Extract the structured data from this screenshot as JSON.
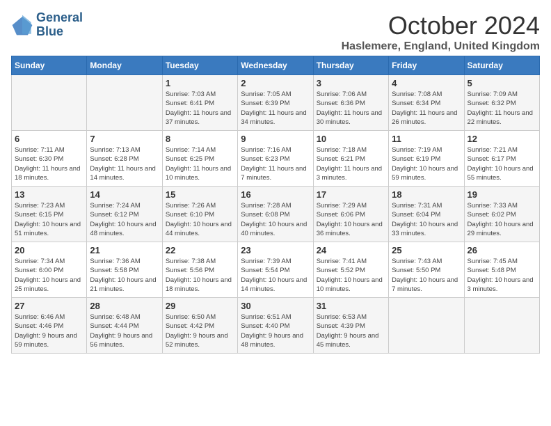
{
  "logo": {
    "line1": "General",
    "line2": "Blue"
  },
  "title": "October 2024",
  "location": "Haslemere, England, United Kingdom",
  "days_header": [
    "Sunday",
    "Monday",
    "Tuesday",
    "Wednesday",
    "Thursday",
    "Friday",
    "Saturday"
  ],
  "weeks": [
    [
      {
        "day": "",
        "info": ""
      },
      {
        "day": "",
        "info": ""
      },
      {
        "day": "1",
        "info": "Sunrise: 7:03 AM\nSunset: 6:41 PM\nDaylight: 11 hours and 37 minutes."
      },
      {
        "day": "2",
        "info": "Sunrise: 7:05 AM\nSunset: 6:39 PM\nDaylight: 11 hours and 34 minutes."
      },
      {
        "day": "3",
        "info": "Sunrise: 7:06 AM\nSunset: 6:36 PM\nDaylight: 11 hours and 30 minutes."
      },
      {
        "day": "4",
        "info": "Sunrise: 7:08 AM\nSunset: 6:34 PM\nDaylight: 11 hours and 26 minutes."
      },
      {
        "day": "5",
        "info": "Sunrise: 7:09 AM\nSunset: 6:32 PM\nDaylight: 11 hours and 22 minutes."
      }
    ],
    [
      {
        "day": "6",
        "info": "Sunrise: 7:11 AM\nSunset: 6:30 PM\nDaylight: 11 hours and 18 minutes."
      },
      {
        "day": "7",
        "info": "Sunrise: 7:13 AM\nSunset: 6:28 PM\nDaylight: 11 hours and 14 minutes."
      },
      {
        "day": "8",
        "info": "Sunrise: 7:14 AM\nSunset: 6:25 PM\nDaylight: 11 hours and 10 minutes."
      },
      {
        "day": "9",
        "info": "Sunrise: 7:16 AM\nSunset: 6:23 PM\nDaylight: 11 hours and 7 minutes."
      },
      {
        "day": "10",
        "info": "Sunrise: 7:18 AM\nSunset: 6:21 PM\nDaylight: 11 hours and 3 minutes."
      },
      {
        "day": "11",
        "info": "Sunrise: 7:19 AM\nSunset: 6:19 PM\nDaylight: 10 hours and 59 minutes."
      },
      {
        "day": "12",
        "info": "Sunrise: 7:21 AM\nSunset: 6:17 PM\nDaylight: 10 hours and 55 minutes."
      }
    ],
    [
      {
        "day": "13",
        "info": "Sunrise: 7:23 AM\nSunset: 6:15 PM\nDaylight: 10 hours and 51 minutes."
      },
      {
        "day": "14",
        "info": "Sunrise: 7:24 AM\nSunset: 6:12 PM\nDaylight: 10 hours and 48 minutes."
      },
      {
        "day": "15",
        "info": "Sunrise: 7:26 AM\nSunset: 6:10 PM\nDaylight: 10 hours and 44 minutes."
      },
      {
        "day": "16",
        "info": "Sunrise: 7:28 AM\nSunset: 6:08 PM\nDaylight: 10 hours and 40 minutes."
      },
      {
        "day": "17",
        "info": "Sunrise: 7:29 AM\nSunset: 6:06 PM\nDaylight: 10 hours and 36 minutes."
      },
      {
        "day": "18",
        "info": "Sunrise: 7:31 AM\nSunset: 6:04 PM\nDaylight: 10 hours and 33 minutes."
      },
      {
        "day": "19",
        "info": "Sunrise: 7:33 AM\nSunset: 6:02 PM\nDaylight: 10 hours and 29 minutes."
      }
    ],
    [
      {
        "day": "20",
        "info": "Sunrise: 7:34 AM\nSunset: 6:00 PM\nDaylight: 10 hours and 25 minutes."
      },
      {
        "day": "21",
        "info": "Sunrise: 7:36 AM\nSunset: 5:58 PM\nDaylight: 10 hours and 21 minutes."
      },
      {
        "day": "22",
        "info": "Sunrise: 7:38 AM\nSunset: 5:56 PM\nDaylight: 10 hours and 18 minutes."
      },
      {
        "day": "23",
        "info": "Sunrise: 7:39 AM\nSunset: 5:54 PM\nDaylight: 10 hours and 14 minutes."
      },
      {
        "day": "24",
        "info": "Sunrise: 7:41 AM\nSunset: 5:52 PM\nDaylight: 10 hours and 10 minutes."
      },
      {
        "day": "25",
        "info": "Sunrise: 7:43 AM\nSunset: 5:50 PM\nDaylight: 10 hours and 7 minutes."
      },
      {
        "day": "26",
        "info": "Sunrise: 7:45 AM\nSunset: 5:48 PM\nDaylight: 10 hours and 3 minutes."
      }
    ],
    [
      {
        "day": "27",
        "info": "Sunrise: 6:46 AM\nSunset: 4:46 PM\nDaylight: 9 hours and 59 minutes."
      },
      {
        "day": "28",
        "info": "Sunrise: 6:48 AM\nSunset: 4:44 PM\nDaylight: 9 hours and 56 minutes."
      },
      {
        "day": "29",
        "info": "Sunrise: 6:50 AM\nSunset: 4:42 PM\nDaylight: 9 hours and 52 minutes."
      },
      {
        "day": "30",
        "info": "Sunrise: 6:51 AM\nSunset: 4:40 PM\nDaylight: 9 hours and 48 minutes."
      },
      {
        "day": "31",
        "info": "Sunrise: 6:53 AM\nSunset: 4:39 PM\nDaylight: 9 hours and 45 minutes."
      },
      {
        "day": "",
        "info": ""
      },
      {
        "day": "",
        "info": ""
      }
    ]
  ]
}
